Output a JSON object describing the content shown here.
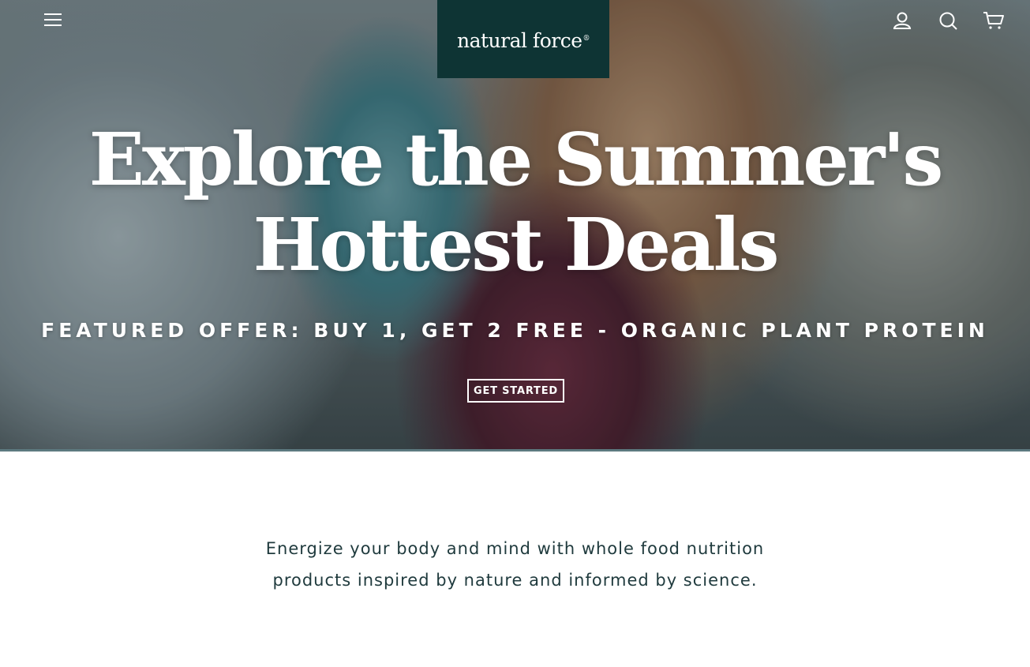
{
  "header": {
    "menu_icon": "hamburger-menu-icon",
    "logo_text": "natural force",
    "logo_mark": "®",
    "logo_bg_color": "#0e3434",
    "icons": [
      "account-icon",
      "search-icon",
      "cart-icon"
    ]
  },
  "hero": {
    "title_line1": "Explore the Summer's",
    "title_line2": "Hottest Deals",
    "subtitle": "FEATURED OFFER: BUY 1, GET 2 FREE - ORGANIC PLANT PROTEIN",
    "cta_label": "GET STARTED"
  },
  "intro": {
    "line1": "Energize your body and mind with whole food nutrition",
    "line2": "products inspired by nature and informed by science."
  }
}
